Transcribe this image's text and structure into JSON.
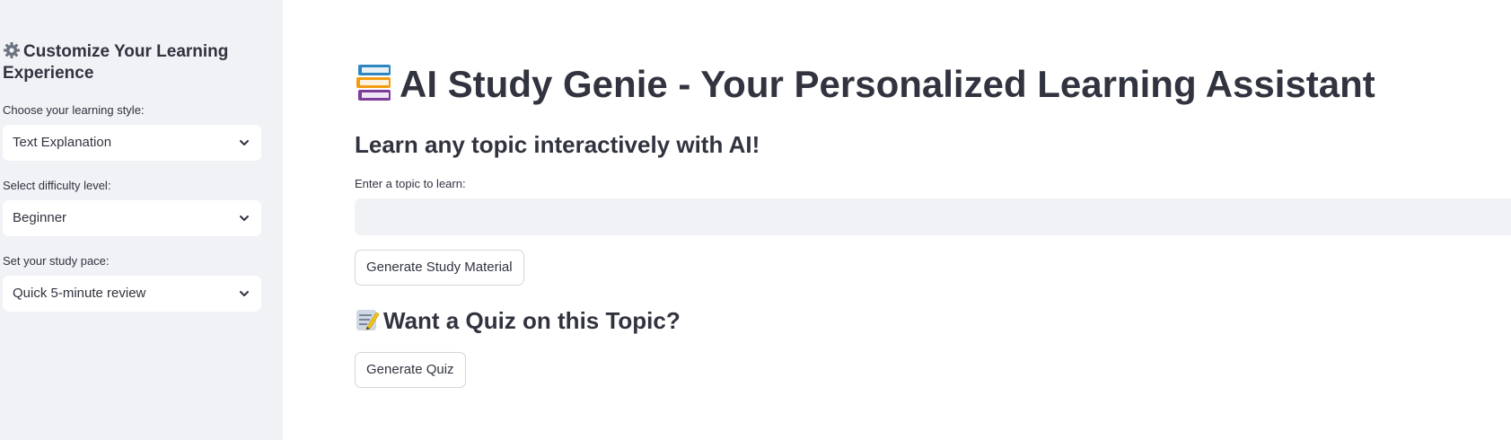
{
  "sidebar": {
    "title": "Customize Your Learning Experience",
    "title_icon": "gear-icon",
    "learning_style": {
      "label": "Choose your learning style:",
      "value": "Text Explanation"
    },
    "difficulty": {
      "label": "Select difficulty level:",
      "value": "Beginner"
    },
    "pace": {
      "label": "Set your study pace:",
      "value": "Quick 5-minute review"
    }
  },
  "main": {
    "title": "AI Study Genie - Your Personalized Learning Assistant",
    "title_icon": "books-icon",
    "subtitle": "Learn any topic interactively with AI!",
    "topic_input": {
      "label": "Enter a topic to learn:",
      "value": "",
      "placeholder": ""
    },
    "generate_button": "Generate Study Material",
    "quiz_heading": "Want a Quiz on this Topic?",
    "quiz_icon": "memo-icon",
    "quiz_button": "Generate Quiz"
  },
  "colors": {
    "sidebar_bg": "#f0f2f6",
    "text": "#31333f",
    "input_bg": "#f0f2f6"
  }
}
